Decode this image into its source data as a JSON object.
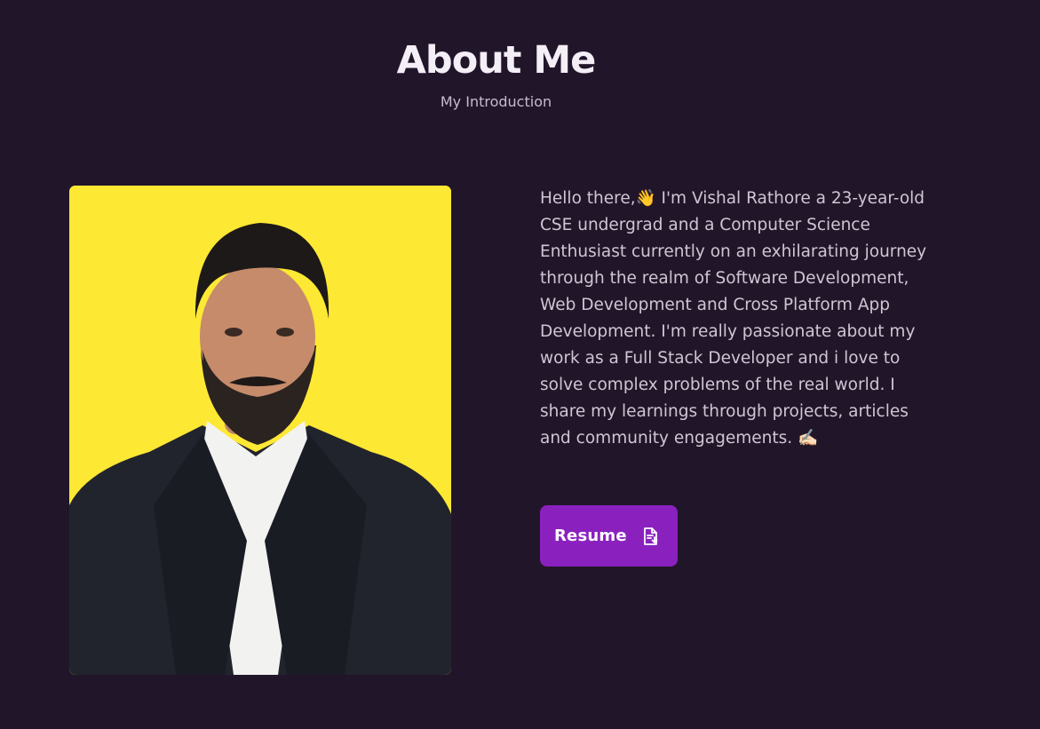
{
  "about": {
    "title": "About Me",
    "subtitle": "My Introduction",
    "bio": "Hello there,👋 I'm Vishal Rathore a 23-year-old CSE undergrad and a Computer Science Enthusiast currently on an exhilarating journey through the realm of Software Development, Web Development and Cross Platform App Development. I'm really passionate about my work as a Full Stack Developer and i love to solve complex problems of the real world. I share my learnings through projects, articles and community engagements. ✍🏻",
    "resume_label": "Resume",
    "resume_icon": "file-download-icon",
    "photo_icon": "profile-photo"
  },
  "colors": {
    "background": "#211629",
    "accent": "#8a21bf",
    "photo_bg": "#fde834"
  }
}
